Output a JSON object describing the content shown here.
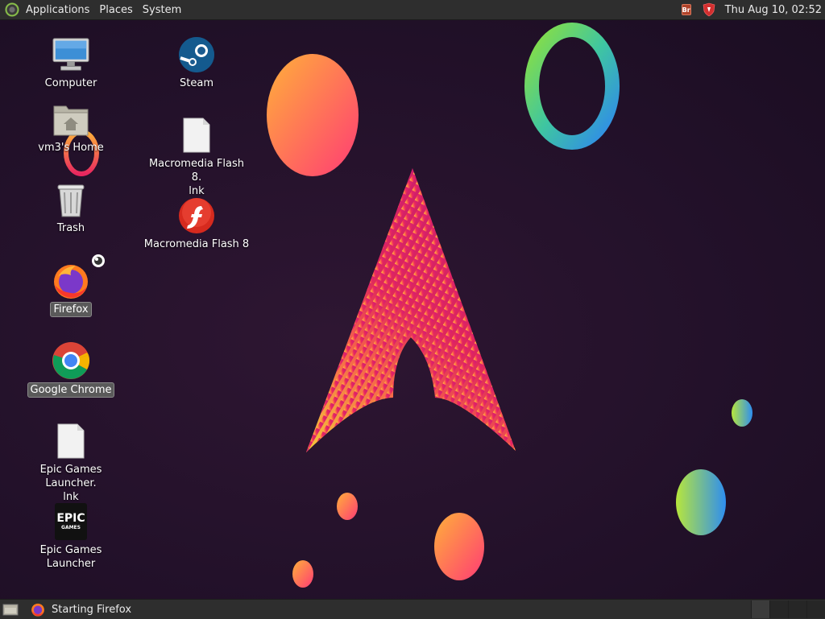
{
  "top_panel": {
    "menus": [
      "Applications",
      "Places",
      "System"
    ],
    "clock": "Thu Aug 10, 02:52",
    "tray_box_text": "Br"
  },
  "desktop_icons": [
    {
      "label": "Computer",
      "icon": "computer-icon",
      "selected": false
    },
    {
      "label": "vm3's Home",
      "icon": "home-folder-icon",
      "selected": false
    },
    {
      "label": "Trash",
      "icon": "trash-icon",
      "selected": false
    },
    {
      "label": "Firefox",
      "icon": "firefox-icon",
      "selected": true
    },
    {
      "label": "Google Chrome",
      "icon": "chrome-icon",
      "selected": true
    },
    {
      "label": "Epic Games Launcher.\nlnk",
      "icon": "file-icon",
      "selected": false
    },
    {
      "label": "Epic Games Launcher",
      "icon": "epic-games-icon",
      "selected": false
    },
    {
      "label": "Steam",
      "icon": "steam-icon",
      "selected": false
    },
    {
      "label": "Macromedia Flash 8.\nlnk",
      "icon": "file-icon",
      "selected": false
    },
    {
      "label": "Macromedia Flash 8",
      "icon": "flash-icon",
      "selected": false
    }
  ],
  "epic_logo_text": {
    "line1": "EPIC",
    "line2": "GAMES"
  },
  "bottom_panel": {
    "task_label": "Starting Firefox",
    "workspaces": 4
  },
  "colors": {
    "panel_bg": "#2e2e2e",
    "wallpaper_bg": "#241128",
    "accent_pink": "#e8275f",
    "accent_orange": "#ff9a3c"
  }
}
